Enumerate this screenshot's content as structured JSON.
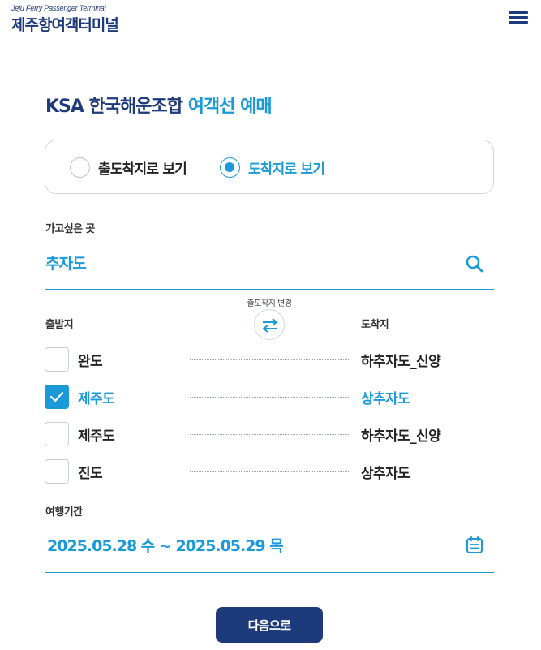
{
  "header": {
    "logo_subtitle": "Jeju Ferry Passenger Terminal",
    "logo_title": "제주항여객터미널",
    "menu_icon": "hamburger-menu-icon"
  },
  "title": {
    "part1": "KSA 한국해운조합",
    "part2": "여객선 예매"
  },
  "view_mode": {
    "options": [
      {
        "label": "출도착지로 보기",
        "selected": false
      },
      {
        "label": "도착지로 보기",
        "selected": true
      }
    ]
  },
  "destination": {
    "label": "가고싶은 곳",
    "value": "추자도",
    "icon": "search-icon"
  },
  "routes": {
    "swap_label": "출도착지 변경",
    "swap_icon": "swap-arrows-icon",
    "origin_header": "출발지",
    "dest_header": "도착지",
    "items": [
      {
        "from": "완도",
        "to": "하추자도_신양",
        "checked": false
      },
      {
        "from": "제주도",
        "to": "상추자도",
        "checked": true
      },
      {
        "from": "제주도",
        "to": "하추자도_신양",
        "checked": false
      },
      {
        "from": "진도",
        "to": "상추자도",
        "checked": false
      }
    ]
  },
  "travel_period": {
    "label": "여행기간",
    "value": "2025.05.28 수 ~ 2025.05.29 목",
    "icon": "calendar-icon"
  },
  "next_button": "다음으로",
  "colors": {
    "navy": "#1d3a7a",
    "accent": "#1a9ad8",
    "border": "#cfd6df"
  }
}
